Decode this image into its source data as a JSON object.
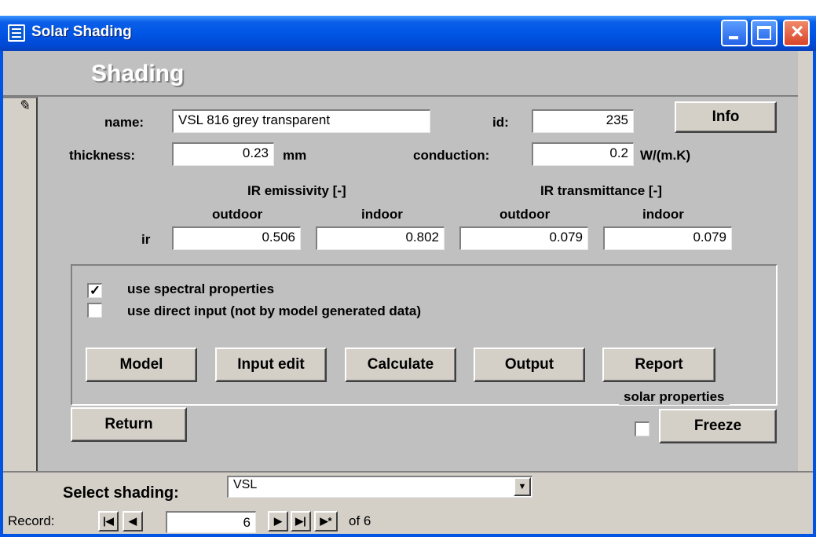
{
  "window": {
    "title": "Solar Shading"
  },
  "form": {
    "heading": "Shading"
  },
  "fields": {
    "name_label": "name:",
    "name_value": "VSL 816 grey transparent",
    "id_label": "id:",
    "id_value": "235",
    "info_button": "Info",
    "thickness_label": "thickness:",
    "thickness_value": "0.23",
    "thickness_unit": "mm",
    "conduction_label": "conduction:",
    "conduction_value": "0.2",
    "conduction_unit": "W/(m.K)"
  },
  "ir": {
    "emissivity_header": "IR emissivity [-]",
    "transmittance_header": "IR transmittance [-]",
    "outdoor_label": "outdoor",
    "indoor_label": "indoor",
    "row_label": "ir",
    "emissivity_outdoor": "0.506",
    "emissivity_indoor": "0.802",
    "transmittance_outdoor": "0.079",
    "transmittance_indoor": "0.079"
  },
  "solar": {
    "group_label": "solar properties",
    "use_spectral_label": "use spectral properties",
    "use_spectral_checked": true,
    "use_direct_label": "use direct input (not by model generated data)",
    "use_direct_checked": false,
    "buttons": {
      "model": "Model",
      "input_edit": "Input edit",
      "calculate": "Calculate",
      "output": "Output",
      "report": "Report"
    }
  },
  "actions": {
    "return": "Return",
    "freeze": "Freeze",
    "freeze_checked": false
  },
  "select": {
    "label": "Select shading:",
    "value": "VSL"
  },
  "record_nav": {
    "label": "Record:",
    "current": "6",
    "of_text": "of 6"
  },
  "icons": {
    "window": "form-icon",
    "pencil": "pencil-icon",
    "minimize": "minimize-icon",
    "maximize": "maximize-icon",
    "close": "close-icon"
  }
}
